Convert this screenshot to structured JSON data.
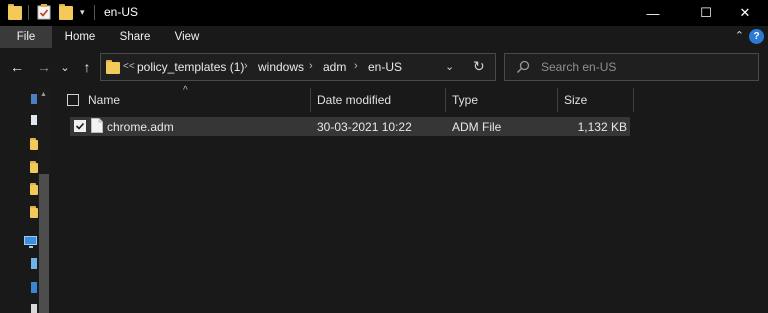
{
  "window": {
    "title": "en-US",
    "controls": {
      "minimize": "—",
      "maximize": "☐",
      "close": "✕"
    }
  },
  "ribbon": {
    "tabs": [
      "File",
      "Home",
      "Share",
      "View"
    ],
    "help": "?",
    "collapse": "⌃"
  },
  "nav": {
    "back": "←",
    "forward": "→",
    "recent": "⌄",
    "up": "↑"
  },
  "address": {
    "overflow": "<<",
    "crumbs": [
      "policy_templates (1)",
      "windows",
      "adm",
      "en-US"
    ],
    "separator": "›",
    "dropdown": "⌄",
    "refresh": "↻"
  },
  "search": {
    "placeholder": "Search en-US"
  },
  "columns": {
    "name": "Name",
    "date": "Date modified",
    "type": "Type",
    "size": "Size",
    "sort_indicator": "^"
  },
  "files": [
    {
      "name": "chrome.adm",
      "date": "30-03-2021 10:22",
      "type": "ADM File",
      "size": "1,132 KB",
      "selected": true
    }
  ],
  "colors": {
    "background": "#191919",
    "titlebar": "#000000",
    "selection": "#363636",
    "folder": "#f3c95a",
    "help_accent": "#2c7ad6"
  }
}
